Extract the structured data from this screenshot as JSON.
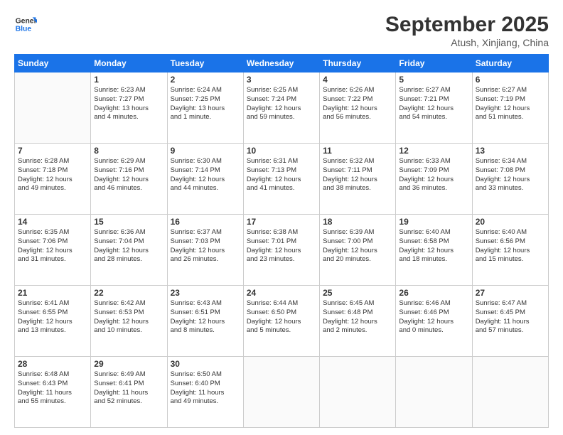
{
  "logo": {
    "line1": "General",
    "line2": "Blue"
  },
  "title": "September 2025",
  "location": "Atush, Xinjiang, China",
  "weekdays": [
    "Sunday",
    "Monday",
    "Tuesday",
    "Wednesday",
    "Thursday",
    "Friday",
    "Saturday"
  ],
  "weeks": [
    [
      {
        "day": "",
        "text": ""
      },
      {
        "day": "1",
        "text": "Sunrise: 6:23 AM\nSunset: 7:27 PM\nDaylight: 13 hours\nand 4 minutes."
      },
      {
        "day": "2",
        "text": "Sunrise: 6:24 AM\nSunset: 7:25 PM\nDaylight: 13 hours\nand 1 minute."
      },
      {
        "day": "3",
        "text": "Sunrise: 6:25 AM\nSunset: 7:24 PM\nDaylight: 12 hours\nand 59 minutes."
      },
      {
        "day": "4",
        "text": "Sunrise: 6:26 AM\nSunset: 7:22 PM\nDaylight: 12 hours\nand 56 minutes."
      },
      {
        "day": "5",
        "text": "Sunrise: 6:27 AM\nSunset: 7:21 PM\nDaylight: 12 hours\nand 54 minutes."
      },
      {
        "day": "6",
        "text": "Sunrise: 6:27 AM\nSunset: 7:19 PM\nDaylight: 12 hours\nand 51 minutes."
      }
    ],
    [
      {
        "day": "7",
        "text": "Sunrise: 6:28 AM\nSunset: 7:18 PM\nDaylight: 12 hours\nand 49 minutes."
      },
      {
        "day": "8",
        "text": "Sunrise: 6:29 AM\nSunset: 7:16 PM\nDaylight: 12 hours\nand 46 minutes."
      },
      {
        "day": "9",
        "text": "Sunrise: 6:30 AM\nSunset: 7:14 PM\nDaylight: 12 hours\nand 44 minutes."
      },
      {
        "day": "10",
        "text": "Sunrise: 6:31 AM\nSunset: 7:13 PM\nDaylight: 12 hours\nand 41 minutes."
      },
      {
        "day": "11",
        "text": "Sunrise: 6:32 AM\nSunset: 7:11 PM\nDaylight: 12 hours\nand 38 minutes."
      },
      {
        "day": "12",
        "text": "Sunrise: 6:33 AM\nSunset: 7:09 PM\nDaylight: 12 hours\nand 36 minutes."
      },
      {
        "day": "13",
        "text": "Sunrise: 6:34 AM\nSunset: 7:08 PM\nDaylight: 12 hours\nand 33 minutes."
      }
    ],
    [
      {
        "day": "14",
        "text": "Sunrise: 6:35 AM\nSunset: 7:06 PM\nDaylight: 12 hours\nand 31 minutes."
      },
      {
        "day": "15",
        "text": "Sunrise: 6:36 AM\nSunset: 7:04 PM\nDaylight: 12 hours\nand 28 minutes."
      },
      {
        "day": "16",
        "text": "Sunrise: 6:37 AM\nSunset: 7:03 PM\nDaylight: 12 hours\nand 26 minutes."
      },
      {
        "day": "17",
        "text": "Sunrise: 6:38 AM\nSunset: 7:01 PM\nDaylight: 12 hours\nand 23 minutes."
      },
      {
        "day": "18",
        "text": "Sunrise: 6:39 AM\nSunset: 7:00 PM\nDaylight: 12 hours\nand 20 minutes."
      },
      {
        "day": "19",
        "text": "Sunrise: 6:40 AM\nSunset: 6:58 PM\nDaylight: 12 hours\nand 18 minutes."
      },
      {
        "day": "20",
        "text": "Sunrise: 6:40 AM\nSunset: 6:56 PM\nDaylight: 12 hours\nand 15 minutes."
      }
    ],
    [
      {
        "day": "21",
        "text": "Sunrise: 6:41 AM\nSunset: 6:55 PM\nDaylight: 12 hours\nand 13 minutes."
      },
      {
        "day": "22",
        "text": "Sunrise: 6:42 AM\nSunset: 6:53 PM\nDaylight: 12 hours\nand 10 minutes."
      },
      {
        "day": "23",
        "text": "Sunrise: 6:43 AM\nSunset: 6:51 PM\nDaylight: 12 hours\nand 8 minutes."
      },
      {
        "day": "24",
        "text": "Sunrise: 6:44 AM\nSunset: 6:50 PM\nDaylight: 12 hours\nand 5 minutes."
      },
      {
        "day": "25",
        "text": "Sunrise: 6:45 AM\nSunset: 6:48 PM\nDaylight: 12 hours\nand 2 minutes."
      },
      {
        "day": "26",
        "text": "Sunrise: 6:46 AM\nSunset: 6:46 PM\nDaylight: 12 hours\nand 0 minutes."
      },
      {
        "day": "27",
        "text": "Sunrise: 6:47 AM\nSunset: 6:45 PM\nDaylight: 11 hours\nand 57 minutes."
      }
    ],
    [
      {
        "day": "28",
        "text": "Sunrise: 6:48 AM\nSunset: 6:43 PM\nDaylight: 11 hours\nand 55 minutes."
      },
      {
        "day": "29",
        "text": "Sunrise: 6:49 AM\nSunset: 6:41 PM\nDaylight: 11 hours\nand 52 minutes."
      },
      {
        "day": "30",
        "text": "Sunrise: 6:50 AM\nSunset: 6:40 PM\nDaylight: 11 hours\nand 49 minutes."
      },
      {
        "day": "",
        "text": ""
      },
      {
        "day": "",
        "text": ""
      },
      {
        "day": "",
        "text": ""
      },
      {
        "day": "",
        "text": ""
      }
    ]
  ]
}
